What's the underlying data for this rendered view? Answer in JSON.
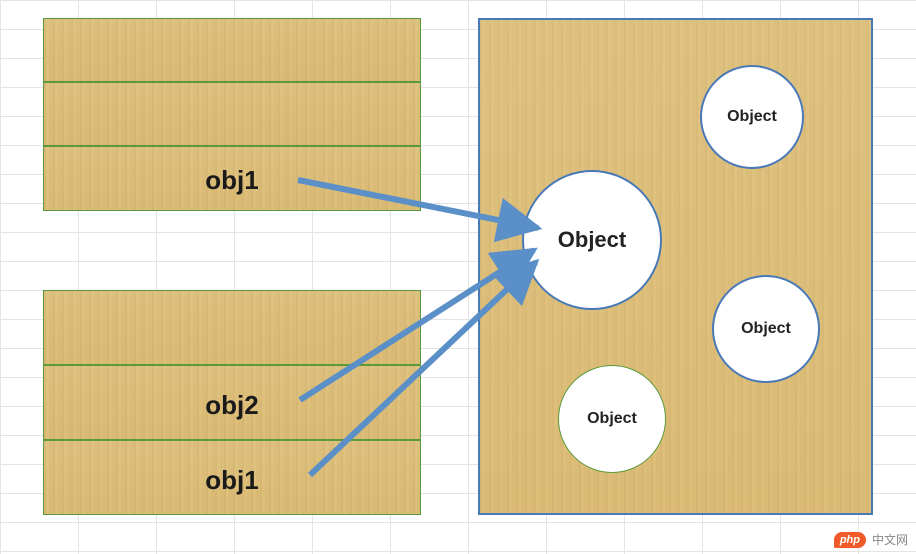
{
  "diagram": {
    "stack_top": {
      "rows": [
        {
          "label": ""
        },
        {
          "label": ""
        },
        {
          "label": "obj1"
        }
      ]
    },
    "stack_bottom": {
      "rows": [
        {
          "label": ""
        },
        {
          "label": "obj2"
        },
        {
          "label": "obj1"
        }
      ]
    },
    "heap": {
      "objects": [
        {
          "label": "Object",
          "role": "main"
        },
        {
          "label": "Object",
          "role": "top-right"
        },
        {
          "label": "Object",
          "role": "right"
        },
        {
          "label": "Object",
          "role": "bottom"
        }
      ]
    },
    "arrows": [
      {
        "from": "stack_top.obj1",
        "to": "heap.main"
      },
      {
        "from": "stack_bottom.obj2",
        "to": "heap.main"
      },
      {
        "from": "stack_bottom.obj1",
        "to": "heap.main"
      }
    ]
  },
  "branding": {
    "badge": "php",
    "text": "中文网"
  },
  "colors": {
    "arrow": "#5a8fc7",
    "wood_border": "#5a9a3c",
    "heap_border": "#4a79b8"
  }
}
